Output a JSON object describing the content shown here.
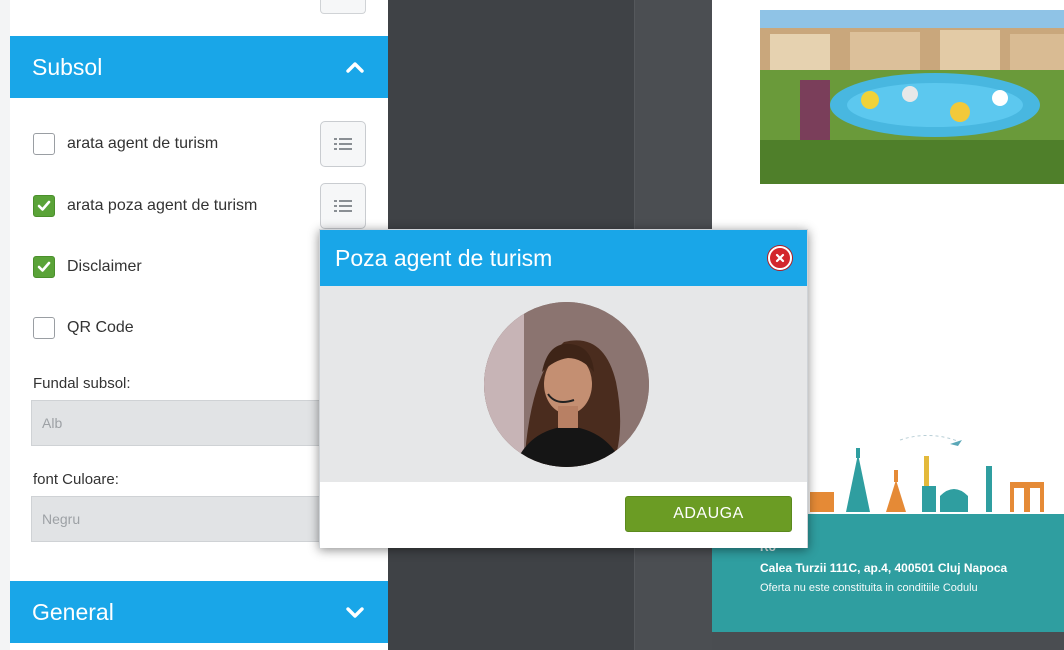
{
  "sidebar": {
    "subsol_header": "Subsol",
    "options": [
      {
        "label": "arata agent de turism",
        "checked": false
      },
      {
        "label": "arata poza agent de turism",
        "checked": true
      },
      {
        "label": "Disclaimer",
        "checked": true
      },
      {
        "label": "QR Code",
        "checked": false
      }
    ],
    "fundal_label": "Fundal subsol:",
    "fundal_value": "Alb",
    "font_label": "font Culoare:",
    "font_value": "Negru",
    "general_header": "General"
  },
  "preview": {
    "footer_line1": "Ro",
    "footer_line2": "Calea Turzii 111C, ap.4, 400501 Cluj Napoca",
    "footer_line3": "Oferta nu este constituita in conditiile Codulu"
  },
  "modal": {
    "title": "Poza agent de turism",
    "add_button": "ADAUGA"
  },
  "colors": {
    "accent_blue": "#19a6e8",
    "checkbox_green": "#5aa338",
    "button_green": "#6b9c24",
    "close_red": "#d3262b",
    "footer_teal": "#2f9ea0"
  },
  "icons": [
    "chevron-up-icon",
    "chevron-down-icon",
    "list-icon",
    "check-icon",
    "close-icon"
  ]
}
